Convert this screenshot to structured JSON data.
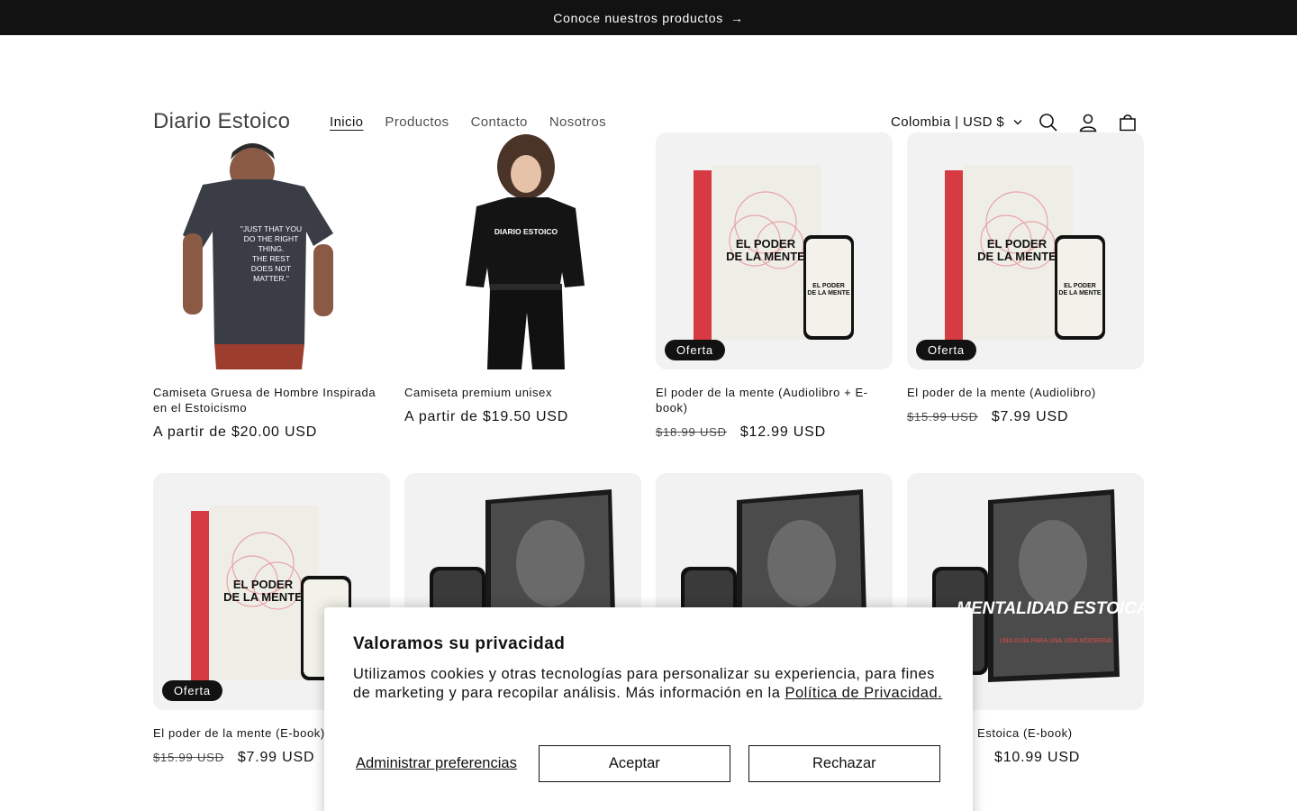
{
  "announcement": {
    "text": "Conoce nuestros productos",
    "arrow": "→"
  },
  "header": {
    "logo": "Diario Estoico",
    "nav": [
      "Inicio",
      "Productos",
      "Contacto",
      "Nosotros"
    ],
    "localization": "Colombia | USD $"
  },
  "products": [
    {
      "title": "Camiseta Gruesa de Hombre Inspirada en el Estoicismo",
      "price": "A partir de $20.00 USD",
      "old_price": "",
      "badge": "",
      "image": "shirt-man",
      "shirt_text": "\"JUST THAT YOU DO THE RIGHT THING. THE REST DOES NOT MATTER.\""
    },
    {
      "title": "Camiseta premium unisex",
      "price": "A partir de $19.50 USD",
      "old_price": "",
      "badge": "",
      "image": "shirt-woman",
      "shirt_text": "DIARIO ESTOICO"
    },
    {
      "title": "El poder de la mente (Audiolibro + E-book)",
      "price": "$12.99 USD",
      "old_price": "$18.99 USD",
      "badge": "Oferta",
      "image": "book-red"
    },
    {
      "title": "El poder de la mente (Audiolibro)",
      "price": "$7.99 USD",
      "old_price": "$15.99 USD",
      "badge": "Oferta",
      "image": "book-red"
    },
    {
      "title": "El poder de la mente (E-book)",
      "price": "$7.99 USD",
      "old_price": "$15.99 USD",
      "badge": "Oferta",
      "image": "book-red"
    },
    {
      "title": "",
      "price": "",
      "old_price": "",
      "badge": "",
      "image": "book-dark"
    },
    {
      "title": "",
      "price": "",
      "old_price": "",
      "badge": "",
      "image": "book-dark"
    },
    {
      "title": "Estoica (E-book)",
      "price": "$10.99 USD",
      "old_price": "",
      "badge": "",
      "image": "book-dark"
    }
  ],
  "cookie": {
    "title": "Valoramos su privacidad",
    "text": "Utilizamos cookies y otras tecnologías para personalizar su experiencia, para fines de marketing y para recopilar análisis. Más información en la ",
    "link": "Política de Privacidad.",
    "manage": "Administrar preferencias",
    "accept": "Aceptar",
    "reject": "Rechazar"
  },
  "book_art": {
    "red_title": "EL PODER DE LA MENTE",
    "dark_title": "MENTALIDAD ESTOICA:",
    "dark_subtitle": "UNA GUÍA PARA UNA VIDA MODERNA"
  }
}
